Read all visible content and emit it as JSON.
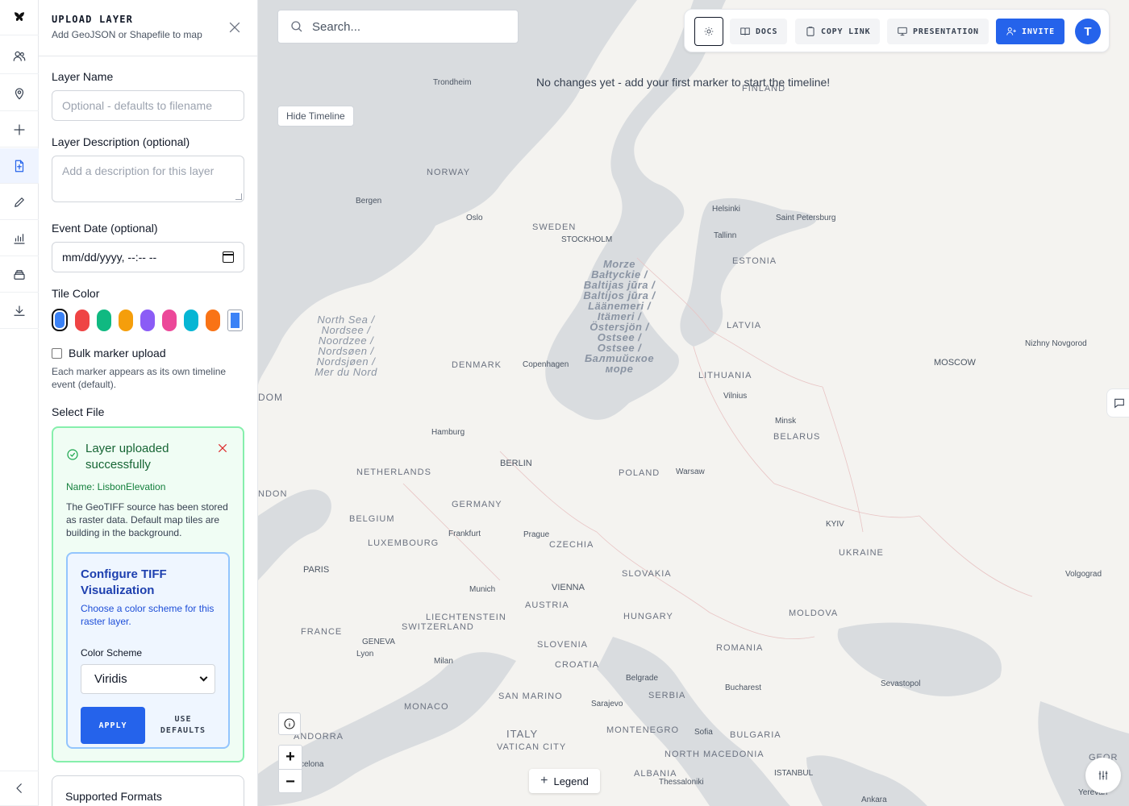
{
  "upload_panel": {
    "title": "UPLOAD LAYER",
    "subtitle": "Add GeoJSON or Shapefile to map",
    "layer_name_label": "Layer Name",
    "layer_name_placeholder": "Optional - defaults to filename",
    "description_label": "Layer Description (optional)",
    "description_placeholder": "Add a description for this layer",
    "event_date_label": "Event Date (optional)",
    "event_date_value": "mm/dd/yyyy, --:-- --",
    "tile_color_label": "Tile Color",
    "tile_colors": [
      "#3b82f6",
      "#ef4444",
      "#10b981",
      "#f59e0b",
      "#8b5cf6",
      "#ec4899",
      "#06b6d4",
      "#f97316"
    ],
    "custom_color": "#3b82f6",
    "bulk_label": "Bulk marker upload",
    "bulk_hint": "Each marker appears as its own timeline event (default).",
    "select_file_label": "Select File",
    "success": {
      "title": "Layer uploaded successfully",
      "name": "Name: LisbonElevation",
      "description": "The GeoTIFF source has been stored as raster data. Default map tiles are building in the background."
    },
    "tiff_config": {
      "title": "Configure TIFF Visualization",
      "description": "Choose a color scheme for this raster layer.",
      "scheme_label": "Color Scheme",
      "scheme_value": "Viridis",
      "apply_label": "APPLY",
      "defaults_label": "USE DEFAULTS"
    },
    "supported_formats_label": "Supported Formats"
  },
  "map": {
    "search_placeholder": "Search...",
    "notice": "No changes yet - add your first marker to start the timeline!",
    "hide_timeline_label": "Hide Timeline",
    "legend_label": "Legend",
    "zoom_in": "+",
    "zoom_out": "−",
    "labels": {
      "finland": "FINLAND",
      "norway": "NORWAY",
      "sweden": "SWEDEN",
      "estonia": "ESTONIA",
      "latvia": "LATVIA",
      "lithuania": "LITHUANIA",
      "belarus": "BELARUS",
      "denmark": "DENMARK",
      "poland": "POLAND",
      "germany": "GERMANY",
      "netherlands": "NETHERLANDS",
      "belgium": "BELGIUM",
      "luxembourg": "LUXEMBOURG",
      "czechia": "CZECHIA",
      "slovakia": "SLOVAKIA",
      "austria": "AUSTRIA",
      "hungary": "HUNGARY",
      "liechtenstein": "LIECHTENSTEIN",
      "switzerland": "SWITZERLAND",
      "france": "FRANCE",
      "slovenia": "SLOVENIA",
      "croatia": "CROATIA",
      "romania": "ROMANIA",
      "moldova": "MOLDOVA",
      "ukraine": "UKRAINE",
      "serbia": "SERBIA",
      "bulgaria": "BULGARIA",
      "montenegro": "MONTENEGRO",
      "north_macedonia": "NORTH MACEDONIA",
      "albania": "ALBANIA",
      "italy": "ITALY",
      "vatican": "VATICAN CITY",
      "san_marino": "SAN MARINO",
      "monaco": "MONACO",
      "andorra": "ANDORRA",
      "georgia": "GEOR",
      "north_sea": "North Sea / Nordsee / Noordzee / Nordsøen / Nordsjøen / Mer du Nord",
      "baltic_sea": "Morze Bałtyckie / Baltijas jūra / Baltijos jūra / Läänemeri / Itämeri / Östersjön / Ostsee / Ostsee / Балтийское море",
      "dom": "DOM",
      "ndon": "NDON"
    },
    "cities": {
      "trondheim": "Trondheim",
      "bergen": "Bergen",
      "oslo": "Oslo",
      "stockholm": "STOCKHOLM",
      "helsinki": "Helsinki",
      "saint_petersburg": "Saint Petersburg",
      "tallinn": "Tallinn",
      "nizhny": "Nizhny Novgorod",
      "moscow": "MOSCOW",
      "copenhagen": "Copenhagen",
      "vilnius": "Vilnius",
      "minsk": "Minsk",
      "hamburg": "Hamburg",
      "berlin": "BERLIN",
      "warsaw": "Warsaw",
      "frankfurt": "Frankfurt",
      "prague": "Prague",
      "kyiv": "KYIV",
      "paris": "PARIS",
      "munich": "Munich",
      "vienna": "VIENNA",
      "volgograd": "Volgograd",
      "geneva": "GENEVA",
      "lyon": "Lyon",
      "milan": "Milan",
      "belgrade": "Belgrade",
      "bucharest": "Bucharest",
      "sevastopol": "Sevastopol",
      "sarajevo": "Sarajevo",
      "sofia": "Sofia",
      "istanbul": "ISTANBUL",
      "thessaloniki": "Thessaloniki",
      "ankara": "Ankara",
      "yerevan": "Yerevan",
      "barcelona": "celona"
    }
  },
  "toolbar": {
    "docs_label": "DOCS",
    "copy_link_label": "COPY LINK",
    "presentation_label": "PRESENTATION",
    "invite_label": "INVITE",
    "avatar_initial": "T"
  },
  "rail_icons": [
    "butterfly-logo-icon",
    "users-icon",
    "map-pin-icon",
    "plus-icon",
    "file-upload-icon",
    "pencil-icon",
    "bar-chart-icon",
    "layers-icon",
    "download-icon",
    "collapse-chevron-icon"
  ]
}
